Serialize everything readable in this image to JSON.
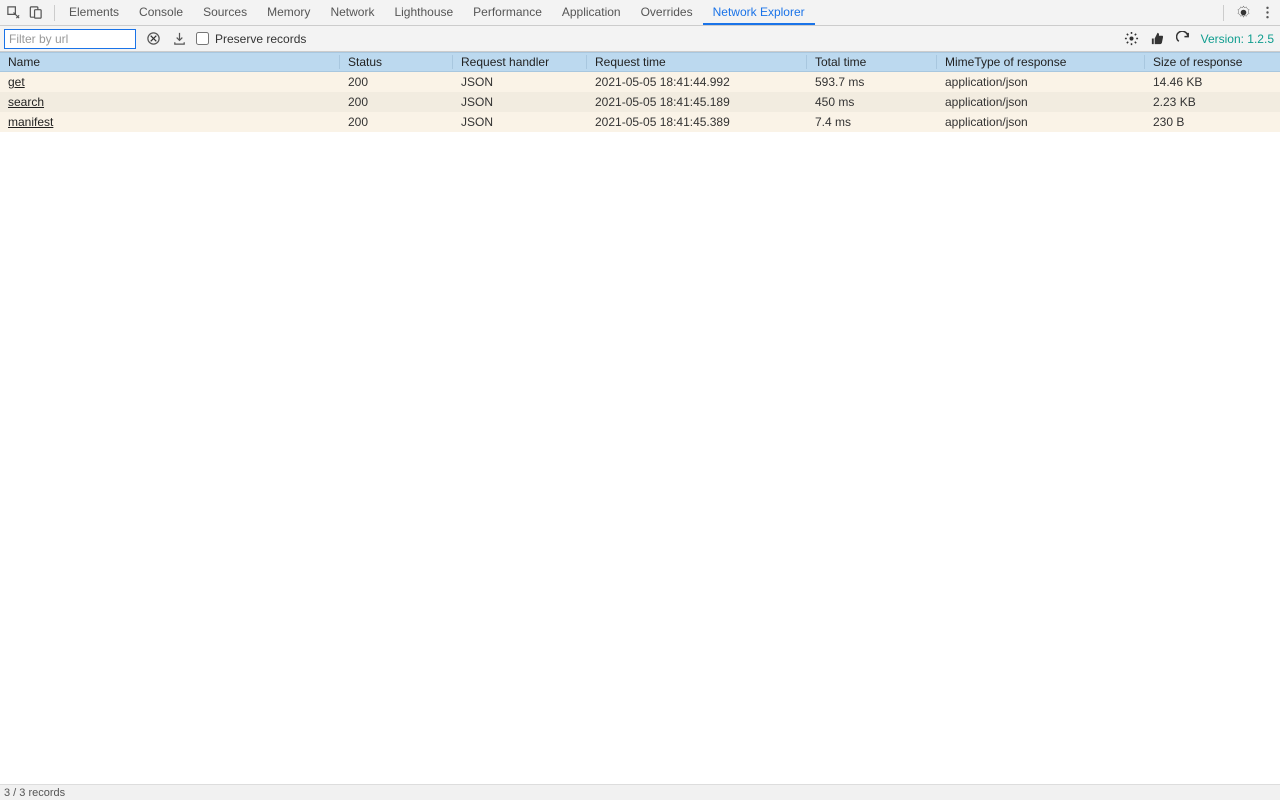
{
  "tabs": [
    {
      "label": "Elements"
    },
    {
      "label": "Console"
    },
    {
      "label": "Sources"
    },
    {
      "label": "Memory"
    },
    {
      "label": "Network"
    },
    {
      "label": "Lighthouse"
    },
    {
      "label": "Performance"
    },
    {
      "label": "Application"
    },
    {
      "label": "Overrides"
    },
    {
      "label": "Network Explorer",
      "active": true
    }
  ],
  "toolbar": {
    "filter_placeholder": "Filter by url",
    "filter_value": "",
    "preserve_records_label": "Preserve records",
    "preserve_records_checked": false,
    "version_label": "Version: 1.2.5"
  },
  "columns": [
    "Name",
    "Status",
    "Request handler",
    "Request time",
    "Total time",
    "MimeType of response",
    "Size of response"
  ],
  "rows": [
    {
      "name": "get",
      "status": "200",
      "handler": "JSON",
      "request_time": "2021-05-05 18:41:44.992",
      "total_time": "593.7 ms",
      "mime": "application/json",
      "size": "14.46 KB"
    },
    {
      "name": "search",
      "status": "200",
      "handler": "JSON",
      "request_time": "2021-05-05 18:41:45.189",
      "total_time": "450 ms",
      "mime": "application/json",
      "size": "2.23 KB"
    },
    {
      "name": "manifest",
      "status": "200",
      "handler": "JSON",
      "request_time": "2021-05-05 18:41:45.389",
      "total_time": "7.4 ms",
      "mime": "application/json",
      "size": "230 B"
    }
  ],
  "footer": {
    "status": "3 / 3 records"
  }
}
